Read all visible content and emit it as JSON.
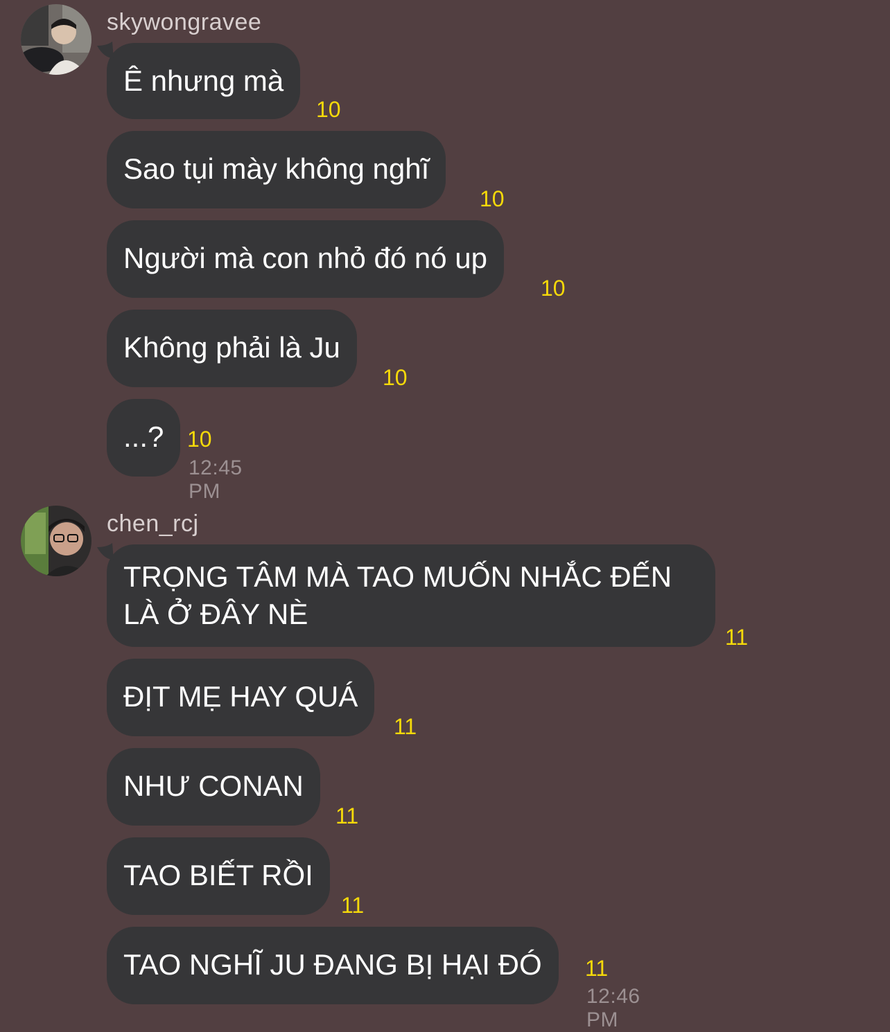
{
  "groups": [
    {
      "username": "skywongravee",
      "messages": [
        {
          "text": "Ê nhưng mà",
          "count": "10"
        },
        {
          "text": "Sao tụi mày không nghĩ",
          "count": "10"
        },
        {
          "text": "Người mà con nhỏ đó nó up",
          "count": "10"
        },
        {
          "text": "Không phải là Ju",
          "count": "10"
        },
        {
          "text": "...?",
          "count": "10"
        }
      ],
      "timestamp": "12:45 PM"
    },
    {
      "username": "chen_rcj",
      "messages": [
        {
          "text": "TRỌNG TÂM MÀ TAO MUỐN NHẮC ĐẾN LÀ Ở ĐÂY NÈ",
          "count": "11"
        },
        {
          "text": "ĐỊT MẸ HAY QUÁ",
          "count": "11"
        },
        {
          "text": "NHƯ CONAN",
          "count": "11"
        },
        {
          "text": "TAO BIẾT RỒI",
          "count": "11"
        },
        {
          "text": "TAO NGHĨ JU ĐANG BỊ HẠI ĐÓ",
          "count": "11"
        }
      ],
      "timestamp": "12:46 PM"
    }
  ],
  "colors": {
    "background": "#523f41",
    "bubble": "#363638",
    "count": "#f5d90a",
    "timestamp": "#9c9092"
  }
}
